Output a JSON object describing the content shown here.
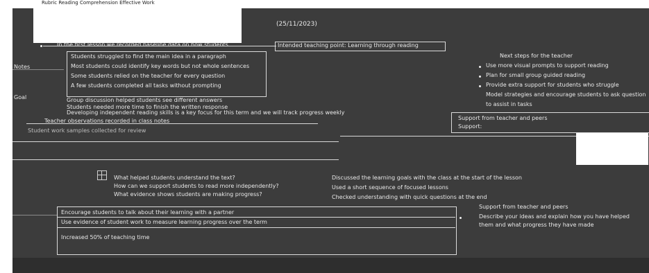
{
  "header": {
    "title": "Rubric Reading Comprehension Effective Work",
    "date": "(25/11/2023)"
  },
  "left": {
    "lead": "In the first lesson we recorded baseline data on how students",
    "items": [
      "Students struggled to find the main idea in a paragraph",
      "Most students could identify key words but not whole sentences",
      "Some students relied on the teacher for every question",
      "A few students completed all tasks without prompting",
      "Group discussion helped students see different answers",
      "Students needed more time to finish the written response"
    ],
    "summary": "Developing independent reading skills is a key focus for this term and we will track progress weekly",
    "subnote": "Teacher observations recorded in class notes",
    "subnote2": "Student work samples collected for review",
    "sidebar_labels": [
      "Notes",
      "Goal"
    ]
  },
  "middle": {
    "heading": "Intended teaching point: Learning through reading",
    "questions": [
      "What helped students understand the text?",
      "How can we support students to read more independently?",
      "What evidence shows students are making progress?"
    ],
    "progress": [
      "Discussed the learning goals with the class at the start of the lesson",
      "Used a short sequence of focused lessons",
      "Checked understanding with quick questions at the end"
    ]
  },
  "right": {
    "heading": "Next steps for the teacher",
    "bullets": [
      "Use more visual prompts to support reading",
      "Plan for small group guided reading",
      "Provide extra support for students who struggle"
    ],
    "note": "Model strategies and encourage students to ask questions",
    "note2": "to assist in tasks",
    "support_label": "Support:",
    "support_title": "Support from teacher and peers",
    "support_text": "Describe your ideas and explain how you have helped",
    "support_text2": "them and what progress they have made"
  },
  "bottom": {
    "lines": [
      "Encourage students to talk about their learning with a partner",
      "Use evidence of student work to measure learning progress over the term",
      "Increased 50% of teaching time"
    ]
  }
}
